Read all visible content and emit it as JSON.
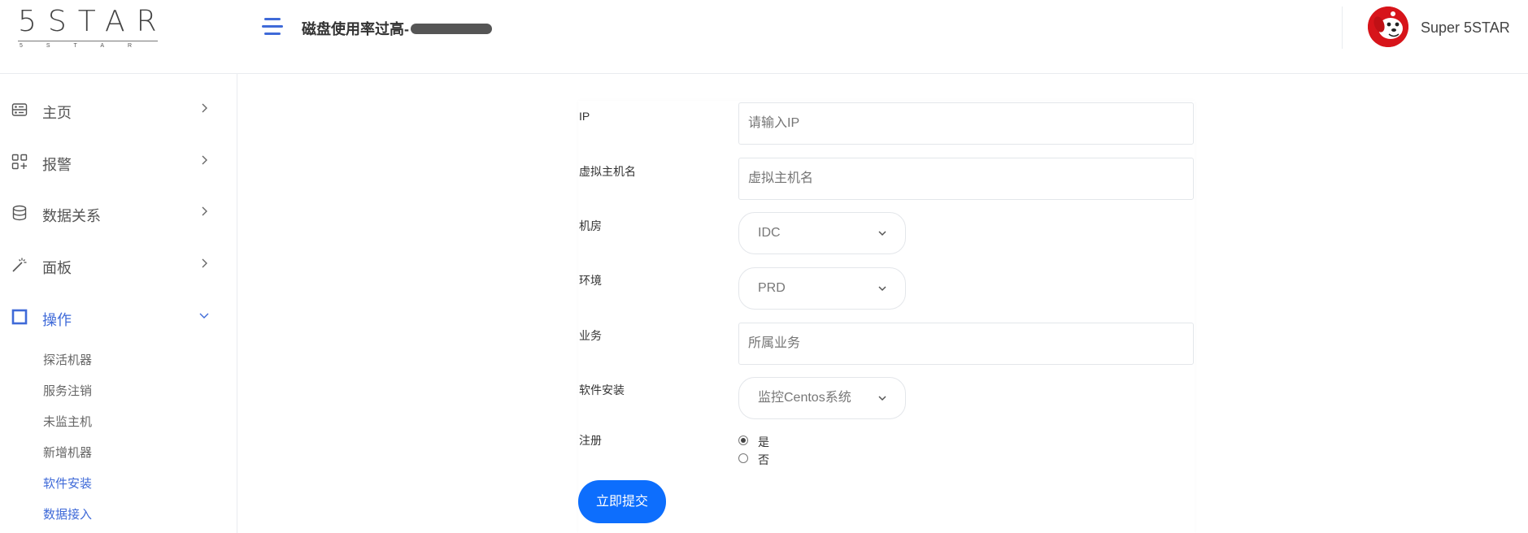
{
  "header": {
    "logo_main": "5STAR",
    "logo_sub": "5STAR",
    "title": "磁盘使用率过高-",
    "user_name": "Super 5STAR"
  },
  "sidebar": {
    "items": [
      {
        "label": "主页",
        "icon": "dashboard-icon"
      },
      {
        "label": "报警",
        "icon": "apps-icon"
      },
      {
        "label": "数据关系",
        "icon": "database-icon"
      },
      {
        "label": "面板",
        "icon": "magic-wand-icon"
      },
      {
        "label": "操作",
        "icon": "square-icon",
        "active": true
      }
    ],
    "sub_items": [
      {
        "label": "探活机器"
      },
      {
        "label": "服务注销"
      },
      {
        "label": "未监主机"
      },
      {
        "label": "新增机器"
      },
      {
        "label": "软件安装",
        "active": true
      },
      {
        "label": "数据接入",
        "active": true
      }
    ]
  },
  "form": {
    "ip": {
      "label": "IP",
      "placeholder": "请输入IP"
    },
    "hostname": {
      "label": "虚拟主机名",
      "placeholder": "虚拟主机名"
    },
    "room": {
      "label": "机房",
      "value": "IDC"
    },
    "env": {
      "label": "环境",
      "value": "PRD"
    },
    "business": {
      "label": "业务",
      "placeholder": "所属业务"
    },
    "software": {
      "label": "软件安装",
      "value": "监控Centos系统"
    },
    "register": {
      "label": "注册",
      "options": [
        {
          "label": "是",
          "checked": true
        },
        {
          "label": "否",
          "checked": false
        }
      ]
    },
    "submit_label": "立即提交"
  },
  "colors": {
    "accent": "#3f6ad8",
    "button": "#0d6efd",
    "avatar": "#d7141a"
  }
}
